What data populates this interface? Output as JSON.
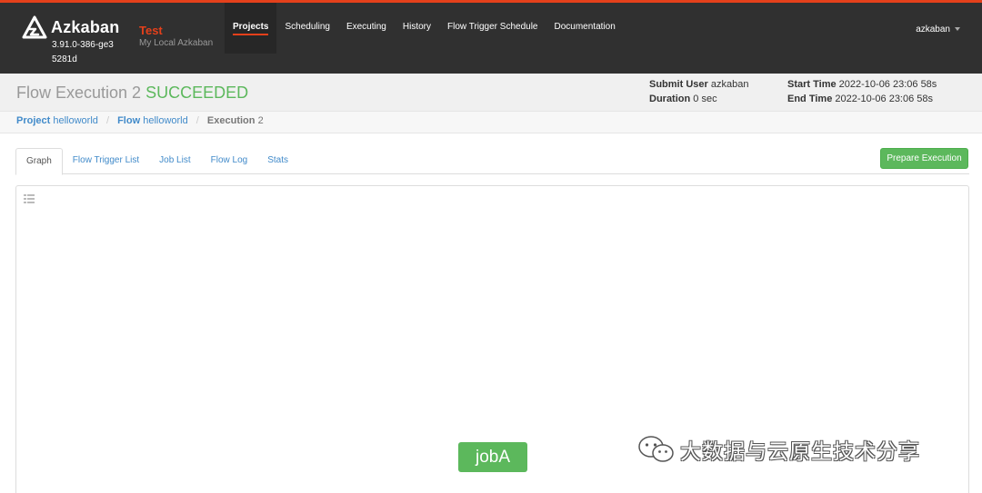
{
  "navbar": {
    "brand": {
      "name": "Azkaban",
      "version": "3.91.0-386-ge35281d"
    },
    "env": {
      "name": "Test",
      "description": "My Local Azkaban"
    },
    "nav_items": [
      {
        "label": "Projects",
        "active": true
      },
      {
        "label": "Scheduling"
      },
      {
        "label": "Executing"
      },
      {
        "label": "History"
      },
      {
        "label": "Flow Trigger Schedule"
      },
      {
        "label": "Documentation"
      }
    ],
    "user": "azkaban"
  },
  "header": {
    "title_prefix": "Flow Execution 2",
    "status": "SUCCEEDED",
    "submit_user_label": "Submit User",
    "submit_user": "azkaban",
    "duration_label": "Duration",
    "duration": "0 sec",
    "start_time_label": "Start Time",
    "start_time": "2022-10-06 23:06 58s",
    "end_time_label": "End Time",
    "end_time": "2022-10-06 23:06 58s"
  },
  "breadcrumb": {
    "project_label": "Project",
    "project": "helloworld",
    "flow_label": "Flow",
    "flow": "helloworld",
    "execution_label": "Execution",
    "execution": "2"
  },
  "tabs": [
    {
      "label": "Graph",
      "active": true
    },
    {
      "label": "Flow Trigger List"
    },
    {
      "label": "Job List"
    },
    {
      "label": "Flow Log"
    },
    {
      "label": "Stats"
    }
  ],
  "prepare_execution_label": "Prepare Execution",
  "graph": {
    "nodes": [
      {
        "label": "jobA",
        "status": "SUCCEEDED"
      }
    ]
  },
  "watermark": {
    "text": "大数据与云原生技术分享",
    "icon": "wechat-icon"
  },
  "colors": {
    "accent": "#e4401b",
    "navbar_bg": "#303030",
    "success": "#5cb85c",
    "link": "#428bca"
  }
}
